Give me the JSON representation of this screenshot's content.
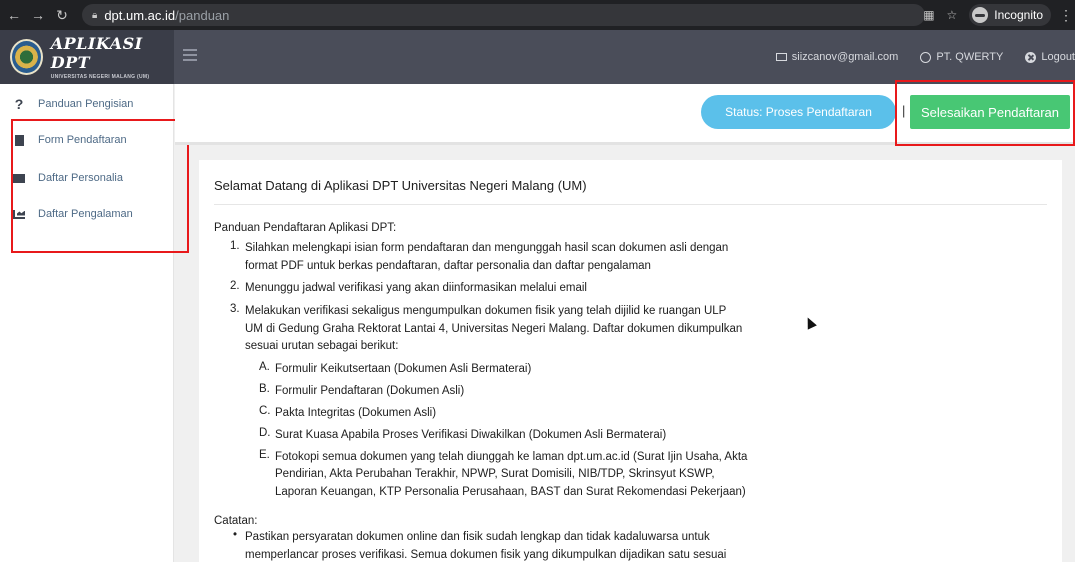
{
  "browser": {
    "url_host": "dpt.um.ac.id",
    "url_path": "/panduan",
    "incognito_label": "Incognito"
  },
  "header": {
    "brand_title": "APLIKASI DPT",
    "brand_subtitle": "UNIVERSITAS NEGERI MALANG (UM)",
    "email": "siizcanov@gmail.com",
    "company": "PT. QWERTY",
    "logout": "Logout"
  },
  "sidebar": {
    "items": [
      {
        "label": "Panduan Pengisian",
        "icon": "question-icon"
      },
      {
        "label": "Form Pendaftaran",
        "icon": "document-icon"
      },
      {
        "label": "Daftar Personalia",
        "icon": "id-card-icon"
      },
      {
        "label": "Daftar Pengalaman",
        "icon": "area-chart-icon"
      }
    ]
  },
  "topbar": {
    "status_label": "Status: Proses Pendaftaran",
    "separator": "|",
    "finish_label": "Selesaikan Pendaftaran"
  },
  "content": {
    "title": "Selamat Datang di Aplikasi DPT Universitas Negeri Malang (UM)",
    "guide_heading": "Panduan Pendaftaran Aplikasi DPT:",
    "steps": [
      {
        "num": "1.",
        "lines": [
          "Silahkan melengkapi isian form pendaftaran dan mengunggah hasil scan dokumen asli dengan",
          "format PDF untuk berkas pendaftaran, daftar personalia dan daftar pengalaman"
        ]
      },
      {
        "num": "2.",
        "lines": [
          "Menunggu jadwal verifikasi yang akan diinformasikan melalui email"
        ]
      },
      {
        "num": "3.",
        "lines": [
          "Melakukan verifikasi sekaligus mengumpulkan dokumen fisik yang telah dijilid ke ruangan ULP",
          "UM di Gedung Graha Rektorat Lantai 4, Universitas Negeri Malang. Daftar dokumen dikumpulkan",
          "sesuai urutan sebagai berikut:"
        ]
      }
    ],
    "documents": [
      {
        "num": "A.",
        "lines": [
          "Formulir Keikutsertaan (Dokumen Asli Bermaterai)"
        ]
      },
      {
        "num": "B.",
        "lines": [
          "Formulir Pendaftaran (Dokumen Asli)"
        ]
      },
      {
        "num": "C.",
        "lines": [
          "Pakta Integritas (Dokumen Asli)"
        ]
      },
      {
        "num": "D.",
        "lines": [
          "Surat Kuasa Apabila Proses Verifikasi Diwakilkan (Dokumen Asli Bermaterai)"
        ]
      },
      {
        "num": "E.",
        "lines": [
          "Fotokopi semua dokumen yang telah diunggah ke laman dpt.um.ac.id (Surat Ijin Usaha, Akta",
          "Pendirian, Akta Perubahan Terakhir, NPWP, Surat Domisili, NIB/TDP, Skrinsyut KSWP,",
          "Laporan Keuangan, KTP Personalia Perusahaan, BAST dan Surat Rekomendasi Pekerjaan)"
        ]
      }
    ],
    "notes_heading": "Catatan:",
    "notes": [
      {
        "bullet": "•",
        "lines": [
          "Pastikan persyaratan dokumen online dan fisik sudah lengkap dan tidak kadaluwarsa untuk",
          "memperlancar proses verifikasi. Semua dokumen fisik yang dikumpulkan dijadikan satu sesuai"
        ]
      }
    ]
  },
  "colors": {
    "header_bg": "#4a4d59",
    "status_blue": "#5bc0ea",
    "finish_green": "#48c774",
    "highlight_red": "#e8191b"
  }
}
